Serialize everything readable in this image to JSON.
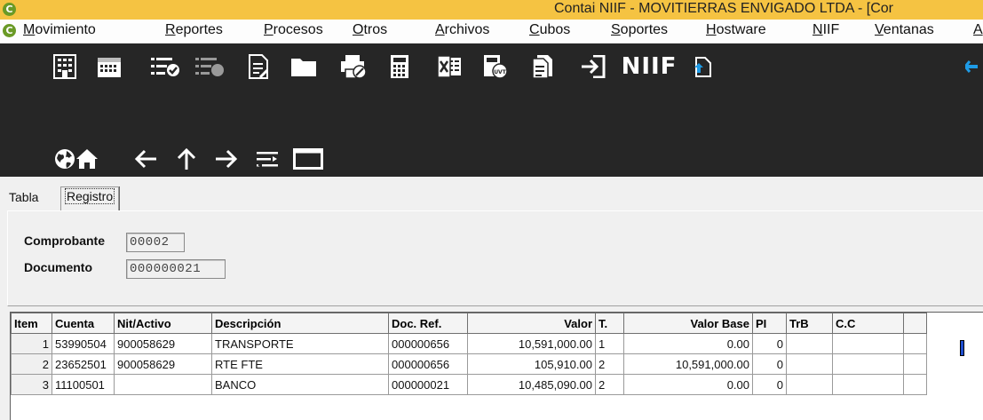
{
  "window": {
    "app_icon_letter": "C",
    "title": "Contai NIIF - MOVITIERRAS ENVIGADO LTDA - [Cor"
  },
  "menu": [
    {
      "underline": "M",
      "rest": "ovimiento"
    },
    {
      "underline": "R",
      "rest": "eportes"
    },
    {
      "underline": "P",
      "rest": "rocesos"
    },
    {
      "underline": "O",
      "rest": "tros"
    },
    {
      "underline": "A",
      "rest": "rchivos"
    },
    {
      "underline": "C",
      "rest": "ubos"
    },
    {
      "underline": "S",
      "rest": "oportes"
    },
    {
      "underline": "H",
      "rest": "ostware"
    },
    {
      "underline": "N",
      "rest": "IIF"
    },
    {
      "underline": "V",
      "rest": "entanas"
    },
    {
      "underline": "A",
      "rest": ""
    }
  ],
  "toolbar": {
    "niif_label": "NIIF"
  },
  "tabs": {
    "tabla": "Tabla",
    "registro": "Registro"
  },
  "form": {
    "comprobante_label": "Comprobante",
    "comprobante_value": "00002",
    "documento_label": "Documento",
    "documento_value": "000000021"
  },
  "grid": {
    "columns": [
      "Item",
      "Cuenta",
      "Nit/Activo",
      "Descripción",
      "Doc. Ref.",
      "Valor",
      "T.",
      "Valor Base",
      "PI",
      "TrB",
      "C.C"
    ],
    "rows": [
      [
        "1",
        "53990504",
        "900058629",
        "TRANSPORTE",
        "000000656",
        "10,591,000.00",
        "1",
        "0.00",
        "0",
        "",
        ""
      ],
      [
        "2",
        "23652501",
        "900058629",
        "RTE FTE",
        "000000656",
        "105,910.00",
        "2",
        "10,591,000.00",
        "0",
        "",
        ""
      ],
      [
        "3",
        "11100501",
        "",
        "BANCO",
        "000000021",
        "10,485,090.00",
        "2",
        "0.00",
        "0",
        "",
        ""
      ]
    ]
  },
  "colors": {
    "title_bar": "#f5c342",
    "toolbar_bg": "#262626",
    "app_icon": "#6a9a26",
    "accent": "#1e9be6"
  }
}
